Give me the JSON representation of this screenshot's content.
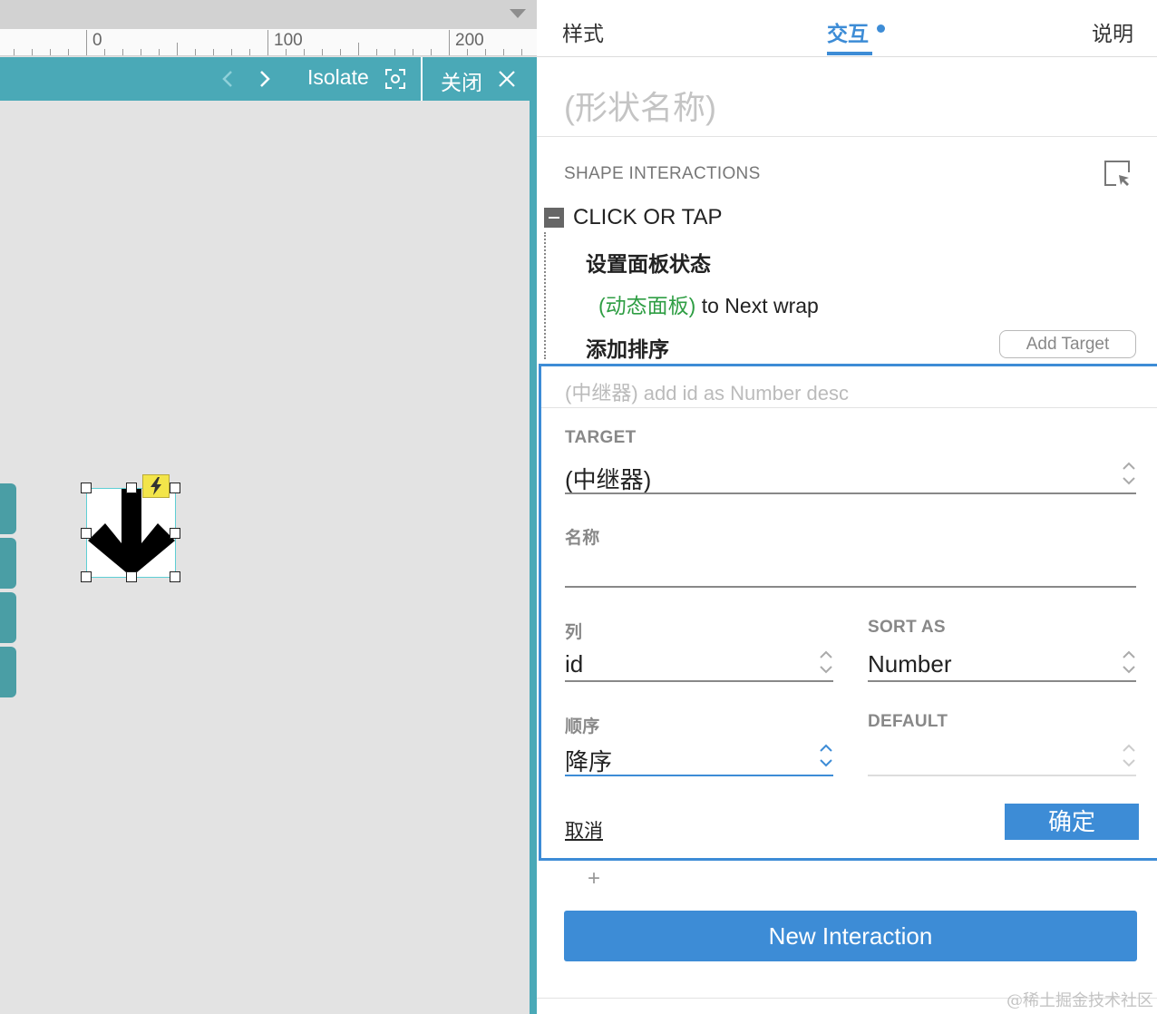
{
  "ruler": {
    "labels": [
      "0",
      "100",
      "200"
    ]
  },
  "toolbar": {
    "isolate_label": "Isolate",
    "close_label": "关闭"
  },
  "tabs": {
    "style": "样式",
    "interaction": "交互",
    "notes": "说明"
  },
  "panel": {
    "shape_name": "(形状名称)",
    "section_title": "SHAPE INTERACTIONS",
    "event_title": "CLICK OR TAP",
    "actions": [
      {
        "label": "设置面板状态",
        "target_name": "(动态面板)",
        "target_detail": "to Next wrap"
      },
      {
        "label": "添加排序"
      }
    ],
    "add_target_label": "Add Target"
  },
  "editor": {
    "summary": "(中继器) add id as Number desc",
    "target_label": "TARGET",
    "target_value": "(中继器)",
    "name_label": "名称",
    "name_value": "",
    "column_label": "列",
    "column_value": "id",
    "sort_as_label": "SORT AS",
    "sort_as_value": "Number",
    "order_label": "顺序",
    "order_value": "降序",
    "default_label": "DEFAULT",
    "default_value": "",
    "cancel_label": "取消",
    "ok_label": "确定"
  },
  "footer": {
    "plus_label": "+",
    "new_interaction_label": "New Interaction"
  },
  "watermark": "@稀土掘金技术社区",
  "colors": {
    "accent": "#3d8cd6",
    "toolbar": "#4aa9b7",
    "target_green": "#2f9e44"
  }
}
